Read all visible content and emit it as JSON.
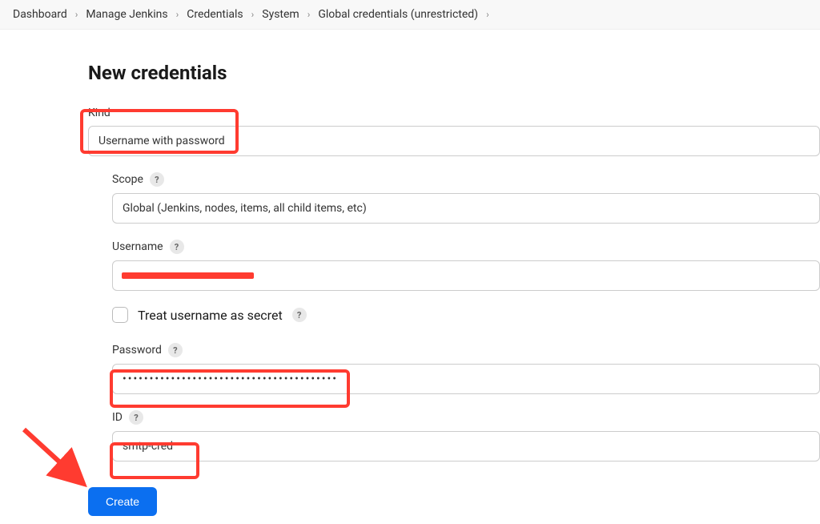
{
  "breadcrumb": {
    "items": [
      "Dashboard",
      "Manage Jenkins",
      "Credentials",
      "System",
      "Global credentials (unrestricted)"
    ]
  },
  "page": {
    "title": "New credentials"
  },
  "form": {
    "kind": {
      "label": "Kind",
      "value": "Username with password"
    },
    "scope": {
      "label": "Scope",
      "value": "Global (Jenkins, nodes, items, all child items, etc)"
    },
    "username": {
      "label": "Username",
      "value": ""
    },
    "treat_secret": {
      "label": "Treat username as secret"
    },
    "password": {
      "label": "Password",
      "value": "••••••••••••••••••••••••••••••••••••••••"
    },
    "id": {
      "label": "ID",
      "value": "smtp-cred"
    },
    "submit": "Create",
    "help": "?"
  }
}
